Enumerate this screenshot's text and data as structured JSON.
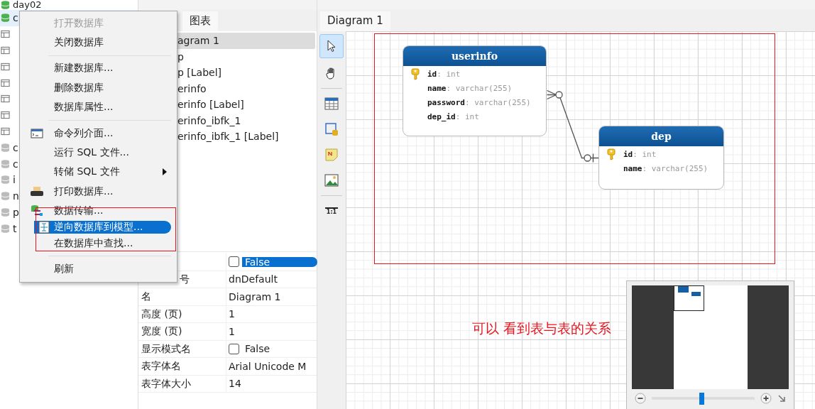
{
  "tree": {
    "items": [
      {
        "label": "day02",
        "selected": false
      },
      {
        "label": "c",
        "selected": true
      },
      {
        "selected": false
      },
      {
        "selected": false
      },
      {
        "selected": false
      },
      {
        "selected": false
      },
      {
        "selected": false
      },
      {
        "selected": false
      },
      {
        "selected": false
      },
      {
        "label": "c",
        "selected": false
      },
      {
        "label": "c",
        "selected": false
      },
      {
        "label": "i",
        "selected": false
      },
      {
        "label": "n",
        "selected": false
      },
      {
        "label": "p",
        "selected": false
      },
      {
        "label": "t",
        "selected": false
      }
    ]
  },
  "context_menu": {
    "groups": [
      [
        {
          "label": "打开数据库",
          "disabled": true,
          "selected": false
        },
        {
          "label": "关闭数据库",
          "disabled": false,
          "selected": false
        }
      ],
      [
        {
          "label": "新建数据库...",
          "disabled": false,
          "selected": false
        },
        {
          "label": "删除数据库",
          "disabled": false,
          "selected": false
        },
        {
          "label": "数据库属性...",
          "disabled": false,
          "selected": false
        }
      ],
      [
        {
          "label": "命令列介面...",
          "disabled": false,
          "selected": false
        },
        {
          "label": "运行 SQL 文件...",
          "disabled": false,
          "selected": false
        },
        {
          "label": "转储 SQL 文件",
          "disabled": false,
          "selected": false,
          "submenu": true
        },
        {
          "label": "打印数据库...",
          "disabled": false,
          "selected": false
        },
        {
          "label": "数据传输...",
          "disabled": false,
          "selected": false
        },
        {
          "label": "逆向数据库到模型...",
          "disabled": false,
          "selected": true
        },
        {
          "label": "在数据库中查找...",
          "disabled": false,
          "selected": false
        }
      ],
      [
        {
          "label": "刷新",
          "disabled": false,
          "selected": false
        }
      ]
    ]
  },
  "object_panel": {
    "tab": "图表",
    "items": [
      {
        "label": "agram 1",
        "selected": true
      },
      {
        "label": "p",
        "selected": false
      },
      {
        "label": "p [Label]",
        "selected": false
      },
      {
        "label": "erinfo",
        "selected": false
      },
      {
        "label": "erinfo [Label]",
        "selected": false
      },
      {
        "label": "erinfo_ibfk_1",
        "selected": false
      },
      {
        "label": "erinfo_ibfk_1 [Label]",
        "selected": false
      }
    ]
  },
  "properties": [
    {
      "kind": "check",
      "value": "False",
      "checked": false,
      "selected": true
    },
    {
      "name": "号",
      "kind": "text",
      "value": "dnDefault"
    },
    {
      "name": "名",
      "kind": "text",
      "value": "Diagram 1"
    },
    {
      "name": "高度 (页)",
      "kind": "text",
      "value": "1"
    },
    {
      "name": "宽度 (页)",
      "kind": "text",
      "value": "1"
    },
    {
      "name": "显示模式名",
      "kind": "check",
      "value": "False",
      "checked": false,
      "selected": false
    },
    {
      "name": "表字体名",
      "kind": "text",
      "value": "Arial Unicode M"
    },
    {
      "name": "表字体大小",
      "kind": "text",
      "value": "14"
    }
  ],
  "editor": {
    "tab": "Diagram 1",
    "tools": [
      {
        "selected": true
      },
      {
        "selected": false
      },
      {
        "selected": false
      },
      {
        "selected": false
      },
      {
        "selected": false
      },
      {
        "selected": false
      },
      {
        "label": "1:1",
        "selected": false
      }
    ],
    "tables": [
      {
        "name": "userinfo",
        "columns": [
          {
            "name": "id",
            "type": ": int",
            "key": true
          },
          {
            "name": "name",
            "type": ": varchar(255)",
            "key": false
          },
          {
            "name": "password",
            "type": ": varchar(255)",
            "key": false
          },
          {
            "name": "dep_id",
            "type": ": int",
            "key": false
          }
        ]
      },
      {
        "name": "dep",
        "columns": [
          {
            "name": "id",
            "type": ": int",
            "key": true
          },
          {
            "name": "name",
            "type": ": varchar(255)",
            "key": false
          }
        ]
      }
    ],
    "annotation": "可以 看到表与表的关系",
    "navigator": {
      "zoom": {
        "level": 0.48
      }
    }
  }
}
